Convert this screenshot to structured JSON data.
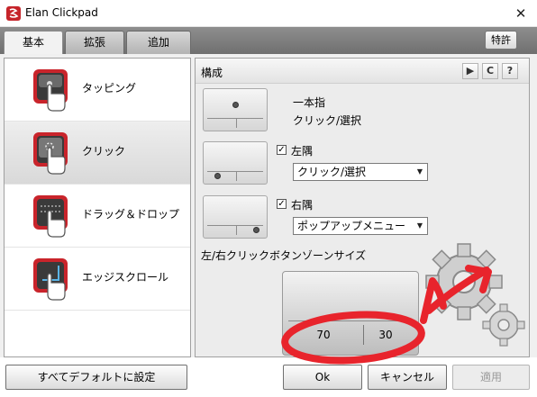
{
  "window": {
    "title": "Elan Clickpad",
    "close_glyph": "✕"
  },
  "tabs": [
    {
      "label": "基本",
      "active": true
    },
    {
      "label": "拡張",
      "active": false
    },
    {
      "label": "追加",
      "active": false
    }
  ],
  "patent_label": "特許",
  "sidebar": {
    "items": [
      {
        "label": "タッピング",
        "icon": "tapping-icon",
        "selected": false
      },
      {
        "label": "クリック",
        "icon": "click-icon",
        "selected": true
      },
      {
        "label": "ドラッグ＆ドロップ",
        "icon": "drag-drop-icon",
        "selected": false
      },
      {
        "label": "エッジスクロール",
        "icon": "edge-scroll-icon",
        "selected": false
      }
    ]
  },
  "panel": {
    "title": "構成",
    "header_icons": [
      "play-icon",
      "reset-icon",
      "help-icon"
    ],
    "play_glyph": "▶",
    "reset_glyph": "C",
    "help_glyph": "?",
    "one_finger": {
      "title": "一本指",
      "subtitle": "クリック/選択"
    },
    "left_corner": {
      "label": "左隅",
      "checked": true,
      "value": "クリック/選択"
    },
    "right_corner": {
      "label": "右隅",
      "checked": true,
      "value": "ポップアップメニュー"
    },
    "zone_label": "左/右クリックボタンゾーンサイズ",
    "zone_left_value": "70",
    "zone_right_value": "30"
  },
  "buttons": {
    "default": "すべてデフォルトに設定",
    "ok": "Ok",
    "cancel": "キャンセル",
    "apply": "適用"
  },
  "checkmark_glyph": "✓",
  "dropdown_glyph": "▼",
  "colors": {
    "accent_red": "#d4202a",
    "annotation_red": "#e8242c"
  }
}
